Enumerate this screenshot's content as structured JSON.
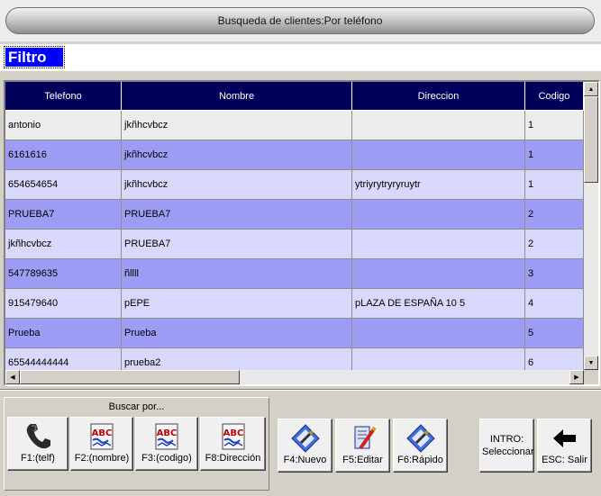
{
  "window": {
    "title": "Busqueda de clientes:Por teléfono"
  },
  "filter": {
    "label": "Filtro",
    "value": ""
  },
  "table": {
    "columns": [
      "Telefono",
      "Nombre",
      "Direccion",
      "Codigo"
    ],
    "rows": [
      [
        "antonio",
        "jkñhcvbcz",
        "",
        "1"
      ],
      [
        "6161616",
        "jkñhcvbcz",
        "",
        "1"
      ],
      [
        "654654654",
        "jkñhcvbcz",
        "ytriyrytryryruytr",
        "1"
      ],
      [
        "PRUEBA7",
        "PRUEBA7",
        "",
        "2"
      ],
      [
        "jkñhcvbcz",
        "PRUEBA7",
        "",
        "2"
      ],
      [
        "547789635",
        "ñllll",
        "",
        "3"
      ],
      [
        "915479640",
        "pEPE",
        "pLAZA DE ESPAÑA 10 5",
        "4"
      ],
      [
        "Prueba",
        "Prueba",
        "",
        "5"
      ],
      [
        "65544444444",
        "prueba2",
        "",
        "6"
      ]
    ]
  },
  "search": {
    "title": "Buscar por...",
    "buttons": [
      {
        "label": "F1:(telf)",
        "icon": "phone-icon"
      },
      {
        "label": "F2:(nombre)",
        "icon": "abc-icon"
      },
      {
        "label": "F3:(codigo)",
        "icon": "abc-icon"
      },
      {
        "label": "F8:Dirección",
        "icon": "abc-icon"
      }
    ]
  },
  "actions": {
    "new": "F4:Nuevo",
    "edit": "F5:Editar",
    "quick": "F6:Rápido",
    "select": "INTRO: Seleccionar",
    "exit": "ESC: Salir"
  },
  "colors": {
    "header": "#00005a",
    "row_light": "#d8d8fc",
    "row_dark": "#9d9df5",
    "row_first": "#ececec",
    "filter_label": "#0000ff"
  }
}
